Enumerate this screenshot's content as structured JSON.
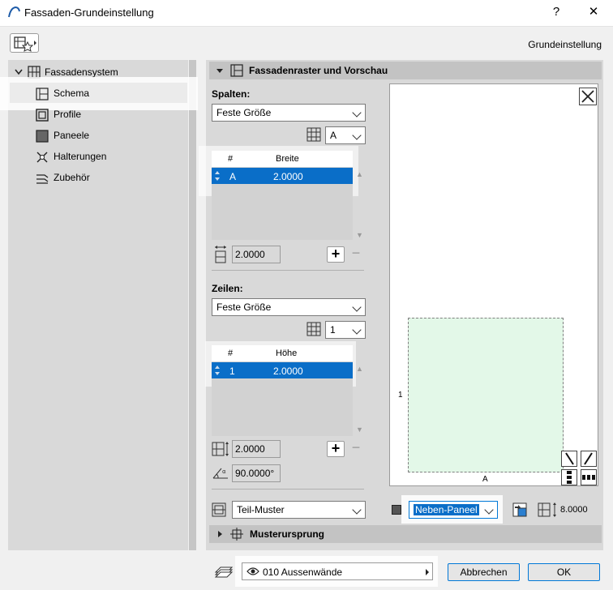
{
  "window": {
    "title": "Fassaden-Grundeinstellung",
    "help": "?",
    "close": "✕"
  },
  "header": {
    "right_label": "Grundeinstellung"
  },
  "tree": {
    "root": "Fassadensystem",
    "items": [
      {
        "label": "Schema",
        "icon": "schema-icon",
        "selected": true
      },
      {
        "label": "Profile",
        "icon": "profile-icon"
      },
      {
        "label": "Paneele",
        "icon": "panel-icon"
      },
      {
        "label": "Halterungen",
        "icon": "joint-icon"
      },
      {
        "label": "Zubehör",
        "icon": "accessory-icon"
      }
    ]
  },
  "section": {
    "title": "Fassadenraster und Vorschau",
    "columns": {
      "label": "Spalten:",
      "mode": "Feste Größe",
      "ref": "A",
      "table": {
        "col_hash": "#",
        "col_value": "Breite",
        "row_id": "A",
        "row_value": "2.0000"
      },
      "size": "2.0000"
    },
    "rows": {
      "label": "Zeilen:",
      "mode": "Feste Größe",
      "ref": "1",
      "table": {
        "col_hash": "#",
        "col_value": "Höhe",
        "row_id": "1",
        "row_value": "2.0000"
      },
      "size": "2.0000",
      "angle": "90.0000°"
    },
    "pattern": "Teil-Muster",
    "panel_type": "Neben-Paneel",
    "panel_height": "8.0000"
  },
  "preview": {
    "col_label": "A",
    "row_label": "1",
    "close": "✕"
  },
  "section2": {
    "title": "Musterursprung"
  },
  "footer": {
    "layer": "010 Aussenwände",
    "cancel": "Abbrechen",
    "ok": "OK"
  },
  "colors": {
    "accent": "#0a6ec8",
    "panel_fill": "#e3f8e8"
  }
}
